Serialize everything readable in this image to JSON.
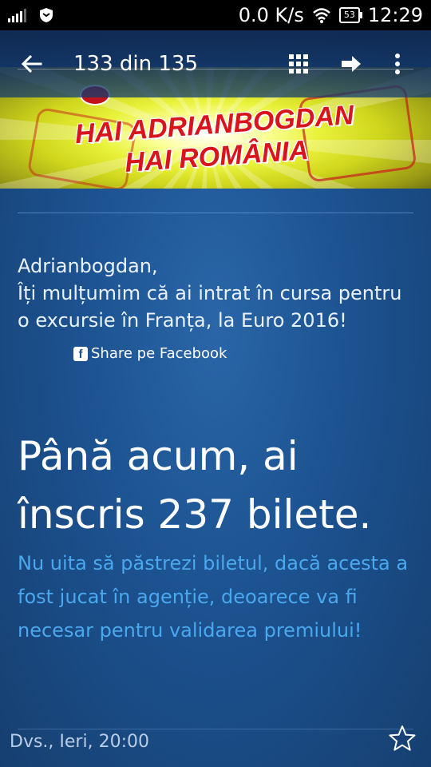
{
  "status_bar": {
    "network_speed": "0.0 K/s",
    "battery": "53",
    "time": "12:29"
  },
  "toolbar": {
    "counter": "133 din 135",
    "icons": [
      "back-arrow-icon",
      "grid-icon",
      "forward-arrow-icon",
      "more-vert-icon"
    ]
  },
  "banner": {
    "line1": "HAI ADRIANBOGDAN",
    "line2": "HAI ROMÂNIA"
  },
  "message": {
    "greeting": "Adrianbogdan,",
    "body": "Îți mulțumim că ai intrat în cursa pentru o excursie în Franța, la Euro 2016!",
    "share_label": "Share pe Facebook",
    "headline_line1": "Până acum, ai",
    "headline_line2": "înscris 237 bilete.",
    "note": "Nu uita să păstrezi biletul, dacă acesta a fost jucat în agenție, deoarece va fi necesar pentru validarea premiului!"
  },
  "footer": {
    "meta": "Dvs., Ieri, 20:00"
  },
  "colors": {
    "background": "#1d4f8a",
    "note_text": "#4aa8ee",
    "banner_text": "#d8151c"
  }
}
